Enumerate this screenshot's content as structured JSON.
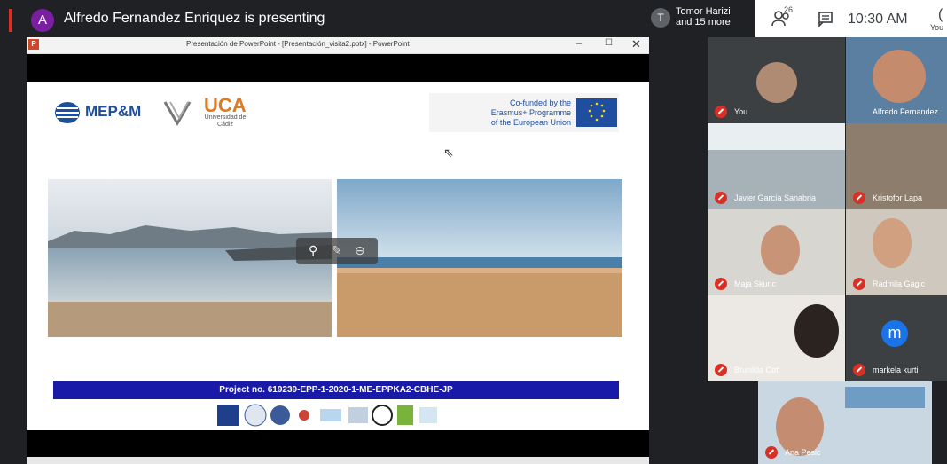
{
  "topbar": {
    "presenter_initial": "A",
    "presenting_text": "Alfredo Fernandez Enriquez is presenting",
    "others_initial": "T",
    "others_name": "Tomor Harizi",
    "others_more": "and 15 more",
    "people_count": "26",
    "time": "10:30 AM",
    "self_label": "You"
  },
  "window": {
    "title": "Presentación de PowerPoint - [Presentación_visita2.pptx] - PowerPoint",
    "min": "–",
    "max": "☐",
    "close": "✕"
  },
  "slide": {
    "logo_mep": "MEP&M",
    "uca_title": "UCA",
    "uca_sub": "Universidad de Cádiz",
    "eu_text_1": "Co-funded by the",
    "eu_text_2": "Erasmus+ Programme",
    "eu_text_3": "of the European Union",
    "project": "Project no. 619239-EPP-1-2020-1-ME-EPPKA2-CBHE-JP"
  },
  "participants": [
    {
      "name": "You"
    },
    {
      "name": "Alfredo Fernandez"
    },
    {
      "name": "Javier García Sanabria"
    },
    {
      "name": "Kristofor Lapa"
    },
    {
      "name": "Maja Skuric"
    },
    {
      "name": "Radmila Gagic"
    },
    {
      "name": "Brunilda Coti"
    },
    {
      "name": "markela kurti",
      "initial": "m"
    },
    {
      "name": "Ana Pesic"
    }
  ],
  "colors": {
    "muted_mic": "#d93025",
    "markela_avatar": "#1a73e8"
  }
}
